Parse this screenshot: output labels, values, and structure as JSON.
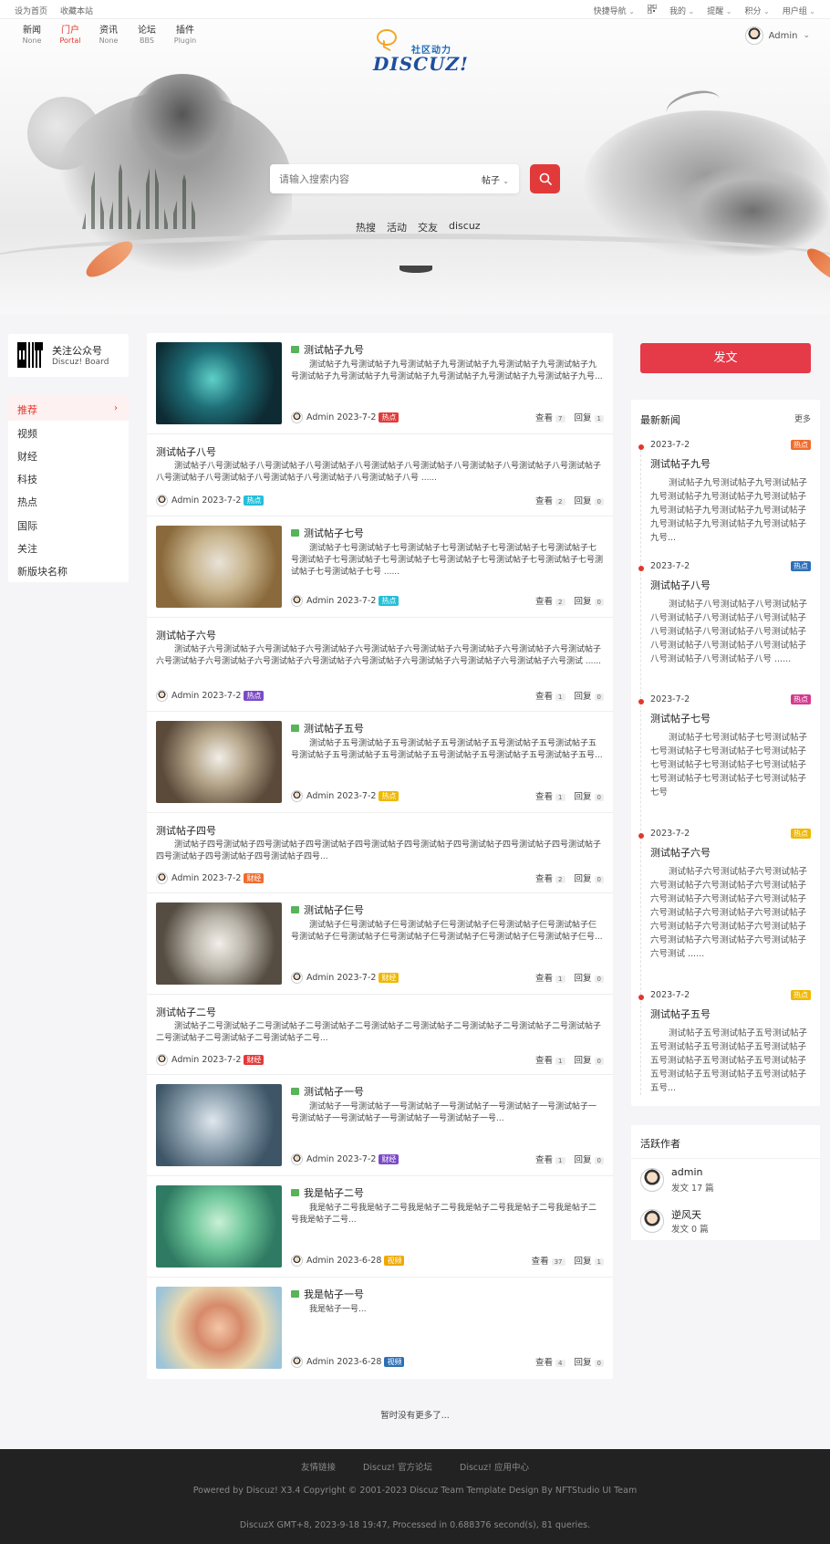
{
  "topbar": {
    "left": [
      "设为首页",
      "收藏本站"
    ],
    "quick_nav": "快捷导航",
    "qr_icon": "qrcode-icon",
    "mine": "我的",
    "remind": "提醒",
    "points": "积分",
    "usergroup": "用户组"
  },
  "nav": [
    {
      "cn": "新闻",
      "en": "None"
    },
    {
      "cn": "门户",
      "en": "Portal"
    },
    {
      "cn": "资讯",
      "en": "None"
    },
    {
      "cn": "论坛",
      "en": "BBS"
    },
    {
      "cn": "插件",
      "en": "Plugin"
    }
  ],
  "logo": {
    "slogan": "社区动力",
    "word": "DISCUZ!"
  },
  "user": {
    "name": "Admin"
  },
  "search": {
    "placeholder": "请输入搜索内容",
    "type": "帖子",
    "hot": [
      "热搜",
      "活动",
      "交友",
      "discuz"
    ]
  },
  "follow": {
    "title": "关注公众号",
    "subtitle": "Discuz! Board"
  },
  "side_nav": [
    "推荐",
    "视频",
    "财经",
    "科技",
    "热点",
    "国际",
    "关注",
    "新版块名称"
  ],
  "colors": {
    "hot": "#24bfd8",
    "finance": "#f06c2e",
    "red": "#e23a3a",
    "purple": "#7b4bc7",
    "yellow": "#f0b800",
    "video": "#f0a800",
    "blue": "#2d6fb7"
  },
  "feed": {
    "stat_view": "查看",
    "stat_reply": "回复",
    "posts": [
      {
        "title": "测试帖子九号",
        "excerpt": "测试帖子九号测试帖子九号测试帖子九号测试帖子九号测试帖子九号测试帖子九号测试帖子九号测试帖子九号测试帖子九号测试帖子九号测试帖子九号测试帖子九号...",
        "author": "Admin",
        "date": "2023-7-2",
        "badge": "热点",
        "views": "7",
        "replies": "1"
      },
      {
        "title": "测试帖子八号",
        "excerpt": "测试帖子八号测试帖子八号测试帖子八号测试帖子八号测试帖子八号测试帖子八号测试帖子八号测试帖子八号测试帖子八号测试帖子八号测试帖子八号测试帖子八号测试帖子八号测试帖子八号 ......",
        "author": "Admin",
        "date": "2023-7-2",
        "badge": "热点",
        "views": "2",
        "replies": "0"
      },
      {
        "title": "测试帖子七号",
        "excerpt": "测试帖子七号测试帖子七号测试帖子七号测试帖子七号测试帖子七号测试帖子七号测试帖子七号测试帖子七号测试帖子七号测试帖子七号测试帖子七号测试帖子七号测试帖子七号测试帖子七号 ......",
        "author": "Admin",
        "date": "2023-7-2",
        "badge": "热点",
        "views": "2",
        "replies": "0"
      },
      {
        "title": "测试帖子六号",
        "excerpt": "测试帖子六号测试帖子六号测试帖子六号测试帖子六号测试帖子六号测试帖子六号测试帖子六号测试帖子六号测试帖子六号测试帖子六号测试帖子六号测试帖子六号测试帖子六号测试帖子六号测试帖子六号测试帖子六号测试帖子六号测试 ......",
        "author": "Admin",
        "date": "2023-7-2",
        "badge": "热点",
        "views": "1",
        "replies": "0"
      },
      {
        "title": "测试帖子五号",
        "excerpt": "测试帖子五号测试帖子五号测试帖子五号测试帖子五号测试帖子五号测试帖子五号测试帖子五号测试帖子五号测试帖子五号测试帖子五号测试帖子五号测试帖子五号...",
        "author": "Admin",
        "date": "2023-7-2",
        "badge": "热点",
        "views": "1",
        "replies": "0"
      },
      {
        "title": "测试帖子四号",
        "excerpt": "测试帖子四号测试帖子四号测试帖子四号测试帖子四号测试帖子四号测试帖子四号测试帖子四号测试帖子四号测试帖子四号测试帖子四号测试帖子四号测试帖子四号...",
        "author": "Admin",
        "date": "2023-7-2",
        "badge": "财经",
        "views": "2",
        "replies": "0"
      },
      {
        "title": "测试帖子仨号",
        "excerpt": "测试帖子仨号测试帖子仨号测试帖子仨号测试帖子仨号测试帖子仨号测试帖子仨号测试帖子仨号测试帖子仨号测试帖子仨号测试帖子仨号测试帖子仨号测试帖子仨号...",
        "author": "Admin",
        "date": "2023-7-2",
        "badge": "财经",
        "views": "1",
        "replies": "0"
      },
      {
        "title": "测试帖子二号",
        "excerpt": "测试帖子二号测试帖子二号测试帖子二号测试帖子二号测试帖子二号测试帖子二号测试帖子二号测试帖子二号测试帖子二号测试帖子二号测试帖子二号测试帖子二号...",
        "author": "Admin",
        "date": "2023-7-2",
        "badge": "财经",
        "views": "1",
        "replies": "0"
      },
      {
        "title": "测试帖子一号",
        "excerpt": "测试帖子一号测试帖子一号测试帖子一号测试帖子一号测试帖子一号测试帖子一号测试帖子一号测试帖子一号测试帖子一号测试帖子一号...",
        "author": "Admin",
        "date": "2023-7-2",
        "badge": "财经",
        "views": "1",
        "replies": "0"
      },
      {
        "title": "我是帖子二号",
        "excerpt": "我是帖子二号我是帖子二号我是帖子二号我是帖子二号我是帖子二号我是帖子二号我是帖子二号...",
        "author": "Admin",
        "date": "2023-6-28",
        "badge": "视频",
        "views": "37",
        "replies": "1"
      },
      {
        "title": "我是帖子一号",
        "excerpt": "我是帖子一号...",
        "author": "Admin",
        "date": "2023-6-28",
        "badge": "视频",
        "views": "4",
        "replies": "0"
      }
    ],
    "end_note": "暂时没有更多了..."
  },
  "post_button": "发文",
  "news": {
    "title": "最新新闻",
    "more": "更多",
    "items": [
      {
        "date": "2023-7-2",
        "badge": "热点",
        "title": "测试帖子九号",
        "text": "测试帖子九号测试帖子九号测试帖子九号测试帖子九号测试帖子九号测试帖子九号测试帖子九号测试帖子九号测试帖子九号测试帖子九号测试帖子九号测试帖子九号..."
      },
      {
        "date": "2023-7-2",
        "badge": "热点",
        "title": "测试帖子八号",
        "text": "测试帖子八号测试帖子八号测试帖子八号测试帖子八号测试帖子八号测试帖子八号测试帖子八号测试帖子八号测试帖子八号测试帖子八号测试帖子八号测试帖子八号测试帖子八号测试帖子八号 ......"
      },
      {
        "date": "2023-7-2",
        "badge": "热点",
        "title": "测试帖子七号",
        "text": "测试帖子七号测试帖子七号测试帖子七号测试帖子七号测试帖子七号测试帖子七号测试帖子七号测试帖子七号测试帖子七号测试帖子七号测试帖子七号测试帖子七号"
      },
      {
        "date": "2023-7-2",
        "badge": "热点",
        "title": "测试帖子六号",
        "text": "测试帖子六号测试帖子六号测试帖子六号测试帖子六号测试帖子六号测试帖子六号测试帖子六号测试帖子六号测试帖子六号测试帖子六号测试帖子六号测试帖子六号测试帖子六号测试帖子六号测试帖子六号测试帖子六号测试帖子六号测试帖子六号测试 ......"
      },
      {
        "date": "2023-7-2",
        "badge": "热点",
        "title": "测试帖子五号",
        "text": "测试帖子五号测试帖子五号测试帖子五号测试帖子五号测试帖子五号测试帖子五号测试帖子五号测试帖子五号测试帖子五号测试帖子五号测试帖子五号测试帖子五号..."
      }
    ]
  },
  "authors": {
    "title": "活跃作者",
    "items": [
      {
        "name": "admin",
        "count": "发文 17 篇"
      },
      {
        "name": "逆风天",
        "count": "发文 0 篇"
      }
    ]
  },
  "footer": {
    "links": [
      "友情链接",
      "Discuz! 官方论坛",
      "Discuz! 应用中心"
    ],
    "powered": "Powered by Discuz! X3.4 Copyright © 2001-2023 Discuz Team Template Design By NFTStudio UI Team",
    "gmt": "DiscuzX GMT+8, 2023-9-18 19:47, Processed in 0.688376 second(s), 81 queries."
  }
}
